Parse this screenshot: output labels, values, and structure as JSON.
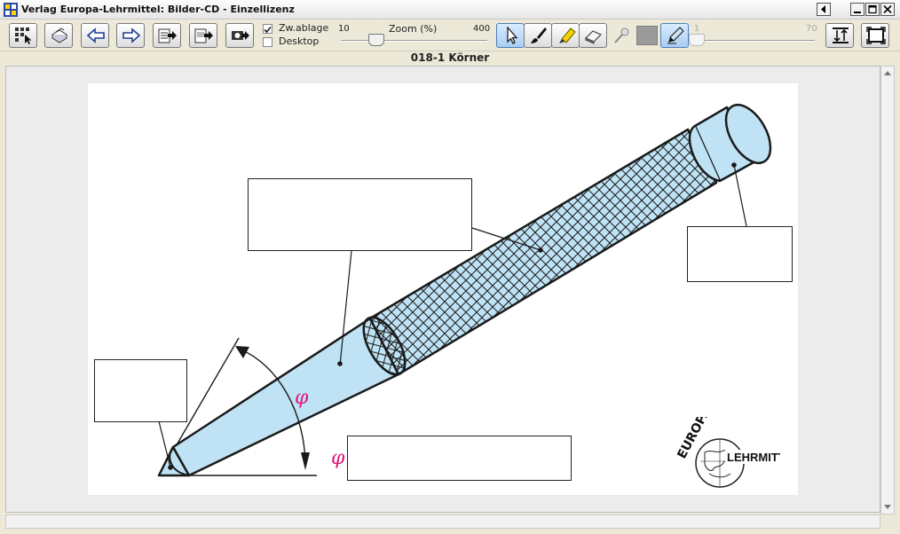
{
  "window": {
    "title": "Verlag Europa-Lehrmittel: Bilder-CD - Einzellizenz"
  },
  "toolbar": {
    "clipboard_label": "Zw.ablage",
    "clipboard_checked": true,
    "desktop_label": "Desktop",
    "desktop_checked": false,
    "zoom_label": "Zoom (%)",
    "zoom_min": "10",
    "zoom_max": "400",
    "zoom_value": 100,
    "line_min": "1",
    "line_max": "70",
    "icons": [
      "thumbnails-icon",
      "print-icon",
      "arrow-left-icon",
      "arrow-right-icon",
      "export-doc-icon",
      "export-page-icon",
      "export-camera-icon",
      "pointer-icon",
      "brush-icon",
      "highlighter-icon",
      "eraser-icon",
      "pin-icon",
      "color-swatch-icon",
      "pen-tool-icon",
      "fit-height-icon",
      "fullscreen-icon"
    ]
  },
  "document": {
    "title": "018-1 Körner"
  },
  "figure": {
    "angle_symbol_1": "φ",
    "angle_symbol_2": "φ",
    "logo_line1": "EUROPA",
    "logo_line2": "LEHRMITTEL",
    "colors": {
      "tool_fill": "#bfe3f5",
      "outline": "#1a1a1a",
      "angle_symbol": "#e0157a"
    }
  }
}
